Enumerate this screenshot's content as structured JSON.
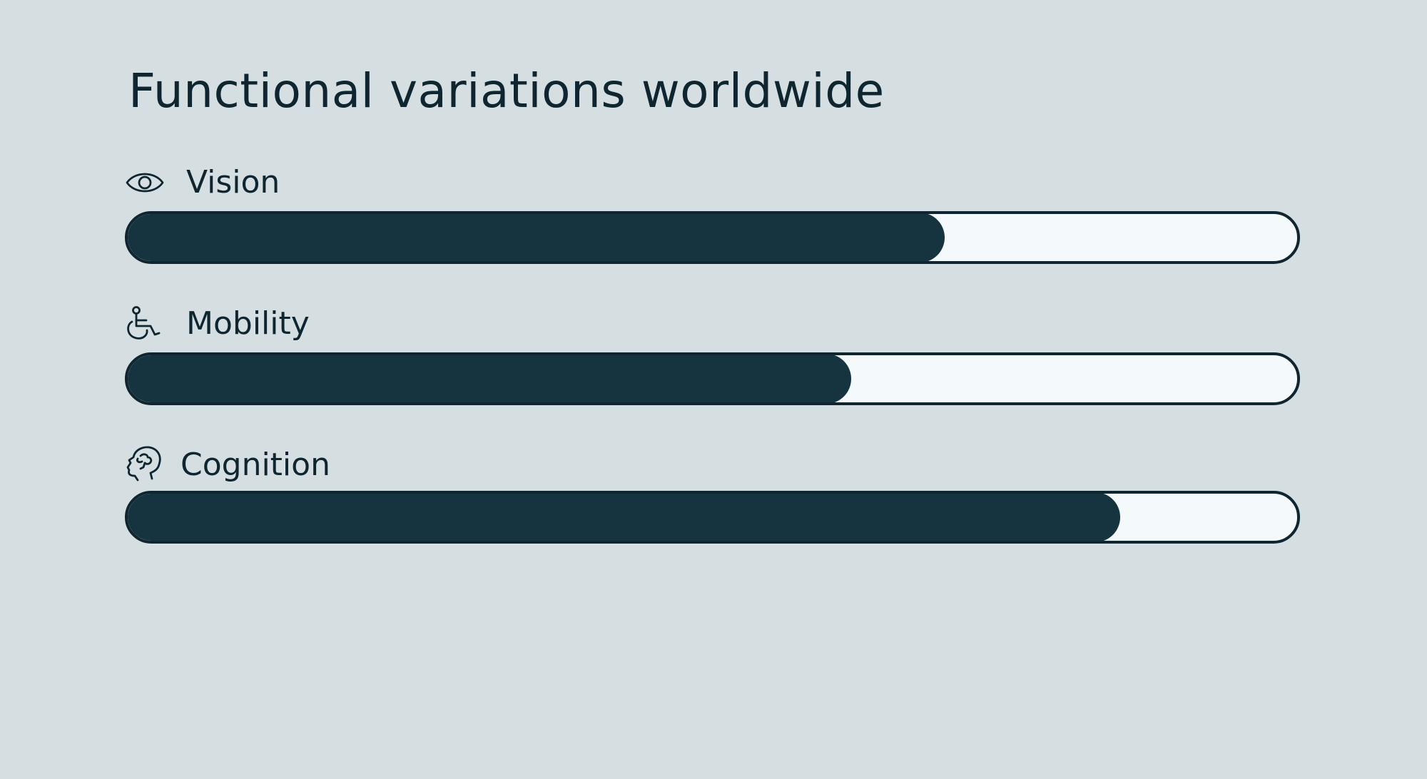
{
  "title": "Functional variations worldwide",
  "colors": {
    "background": "#d5dee1",
    "text": "#0f2530",
    "bar_fill": "#163440",
    "bar_track": "#f4f9fb"
  },
  "metrics": [
    {
      "label": "Vision",
      "icon": "eye-icon",
      "fraction": 0.7
    },
    {
      "label": "Mobility",
      "icon": "wheelchair-icon",
      "fraction": 0.62
    },
    {
      "label": "Cognition",
      "icon": "brain-head-icon",
      "fraction": 0.85
    }
  ]
}
